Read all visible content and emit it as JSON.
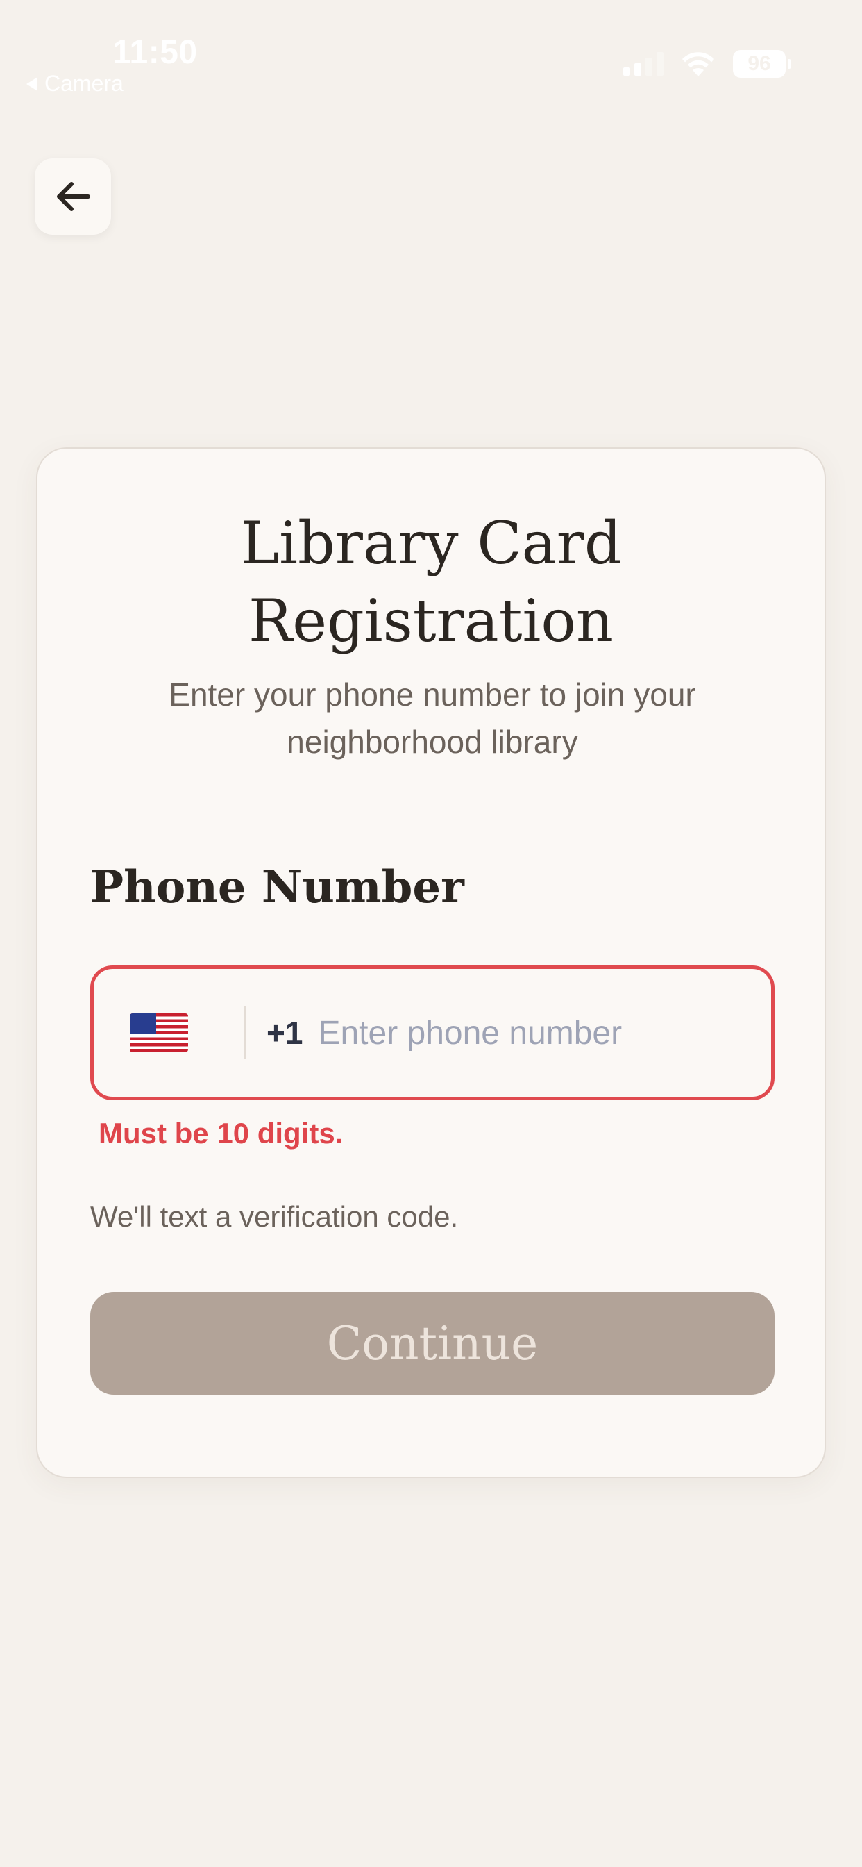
{
  "status_bar": {
    "time": "11:50",
    "back_app": "Camera",
    "battery": "96"
  },
  "header": {
    "back_icon": "arrow-left-icon"
  },
  "card": {
    "title_line1": "Library Card",
    "title_line2": "Registration",
    "subtitle": "Enter your phone number to join your neighborhood library",
    "field_label": "Phone Number",
    "phone": {
      "flag_icon": "us-flag-icon",
      "country_code": "+1",
      "value": "",
      "placeholder": "Enter phone number"
    },
    "error": "Must be 10 digits.",
    "helper": "We'll text a verification code.",
    "continue_label": "Continue"
  },
  "colors": {
    "background": "#f5f1ec",
    "card": "#fbf8f5",
    "error": "#e04a4f",
    "button_disabled": "#b2a398",
    "title": "#2b2621"
  }
}
